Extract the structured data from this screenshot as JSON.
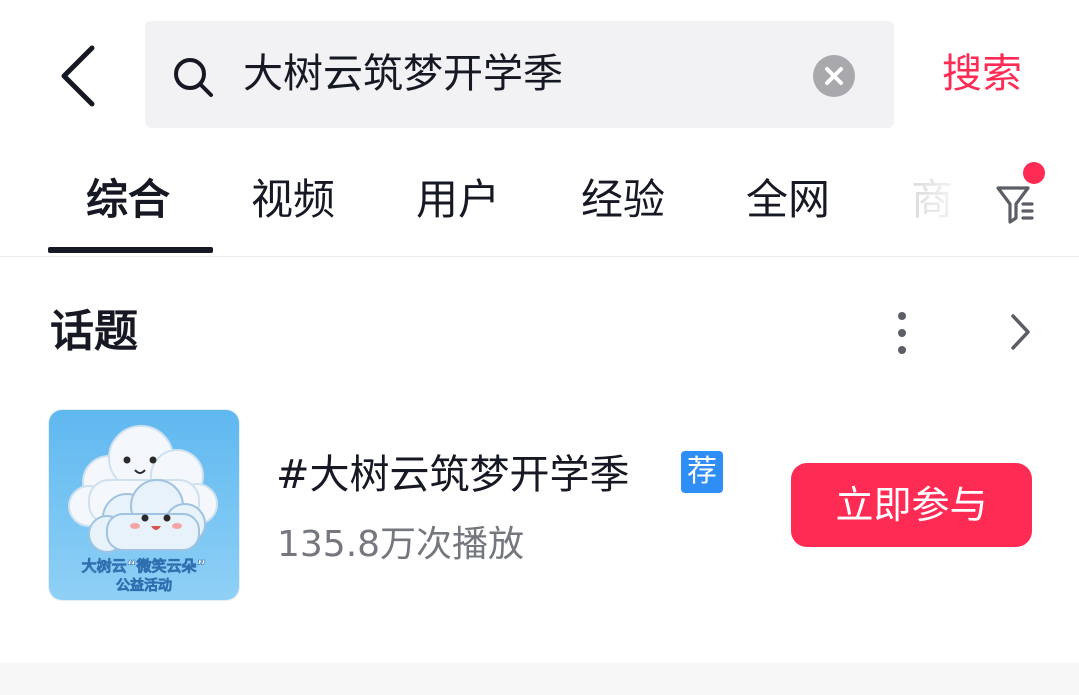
{
  "colors": {
    "accent": "#fe2c55",
    "text_primary": "#161823",
    "text_secondary": "#75777e",
    "search_bg": "#f2f2f4",
    "badge_blue": "#2f8ef5"
  },
  "header": {
    "back_icon": "chevron-left-icon",
    "search": {
      "icon": "search-icon",
      "value": "大树云筑梦开学季",
      "clear_icon": "clear-circle-icon"
    },
    "submit_label": "搜索"
  },
  "tabs": {
    "items": [
      {
        "label": "综合",
        "active": true
      },
      {
        "label": "视频",
        "active": false
      },
      {
        "label": "用户",
        "active": false
      },
      {
        "label": "经验",
        "active": false
      },
      {
        "label": "全网",
        "active": false
      },
      {
        "label": "商",
        "active": false
      }
    ],
    "filter_icon": "filter-icon",
    "filter_has_dot": true
  },
  "topic_section": {
    "title": "话题",
    "more_icon": "more-vertical-icon",
    "arrow_icon": "chevron-right-icon",
    "topic": {
      "name": "#大树云筑梦开学季",
      "badge": "荐",
      "plays": "135.8万次播放",
      "join_label": "立即参与",
      "thumbnail_caption_line1": "大树云“微笑云朵”",
      "thumbnail_caption_line2": "公益活动"
    }
  }
}
